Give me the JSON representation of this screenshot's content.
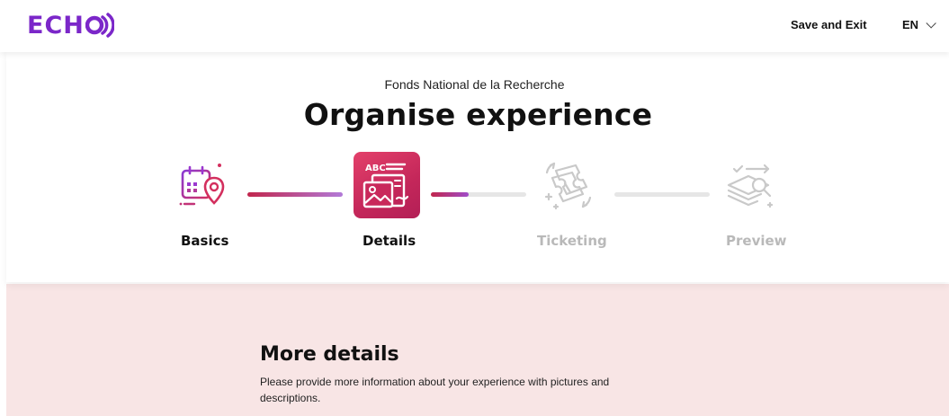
{
  "header": {
    "logo_text": "ECH",
    "save_exit_label": "Save and Exit",
    "language": "EN"
  },
  "organiser": "Fonds National de la Recherche",
  "page_title": "Organise experience",
  "steps": [
    {
      "label": "Basics",
      "state": "completed"
    },
    {
      "label": "Details",
      "state": "active"
    },
    {
      "label": "Ticketing",
      "state": "upcoming"
    },
    {
      "label": "Preview",
      "state": "upcoming"
    }
  ],
  "progress": {
    "basics_to_details": 1.0,
    "details_to_ticketing": 0.4,
    "ticketing_to_preview": 0.0
  },
  "section": {
    "title": "More details",
    "description": "Please provide more information about your experience with pictures and descriptions."
  },
  "colors": {
    "brand": "#7b27c9",
    "accent": "#c4275a",
    "inactive": "#c9c9c9",
    "section_bg": "#f8e5e5"
  }
}
